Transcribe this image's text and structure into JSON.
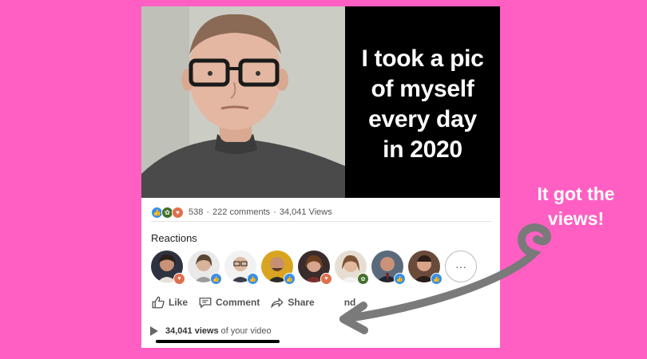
{
  "caption": {
    "line1": "I took a pic",
    "line2": "of myself",
    "line3": "every day",
    "line4": "in 2020"
  },
  "post_stats": {
    "reactions_count": "538",
    "separator1": "·",
    "comments": "222 comments",
    "separator2": "·",
    "views": "34,041 Views"
  },
  "reactions_section": {
    "title": "Reactions",
    "more_label": "···"
  },
  "actions": {
    "like": "Like",
    "comment": "Comment",
    "share": "Share",
    "send": "nd"
  },
  "views_footer": {
    "count": "34,041 views",
    "suffix": "of your video"
  },
  "annotation": {
    "line1": "It got the",
    "line2": "views!"
  },
  "colors": {
    "background": "#ff5fc2",
    "like_blue": "#378fe9",
    "support_green": "#44712e",
    "love_red": "#df704d",
    "arrow_gray": "#7a7a7a"
  },
  "icons": [
    "like-reaction-icon",
    "support-reaction-icon",
    "love-reaction-icon",
    "thumb-up-icon",
    "comment-icon",
    "share-icon",
    "play-icon"
  ]
}
